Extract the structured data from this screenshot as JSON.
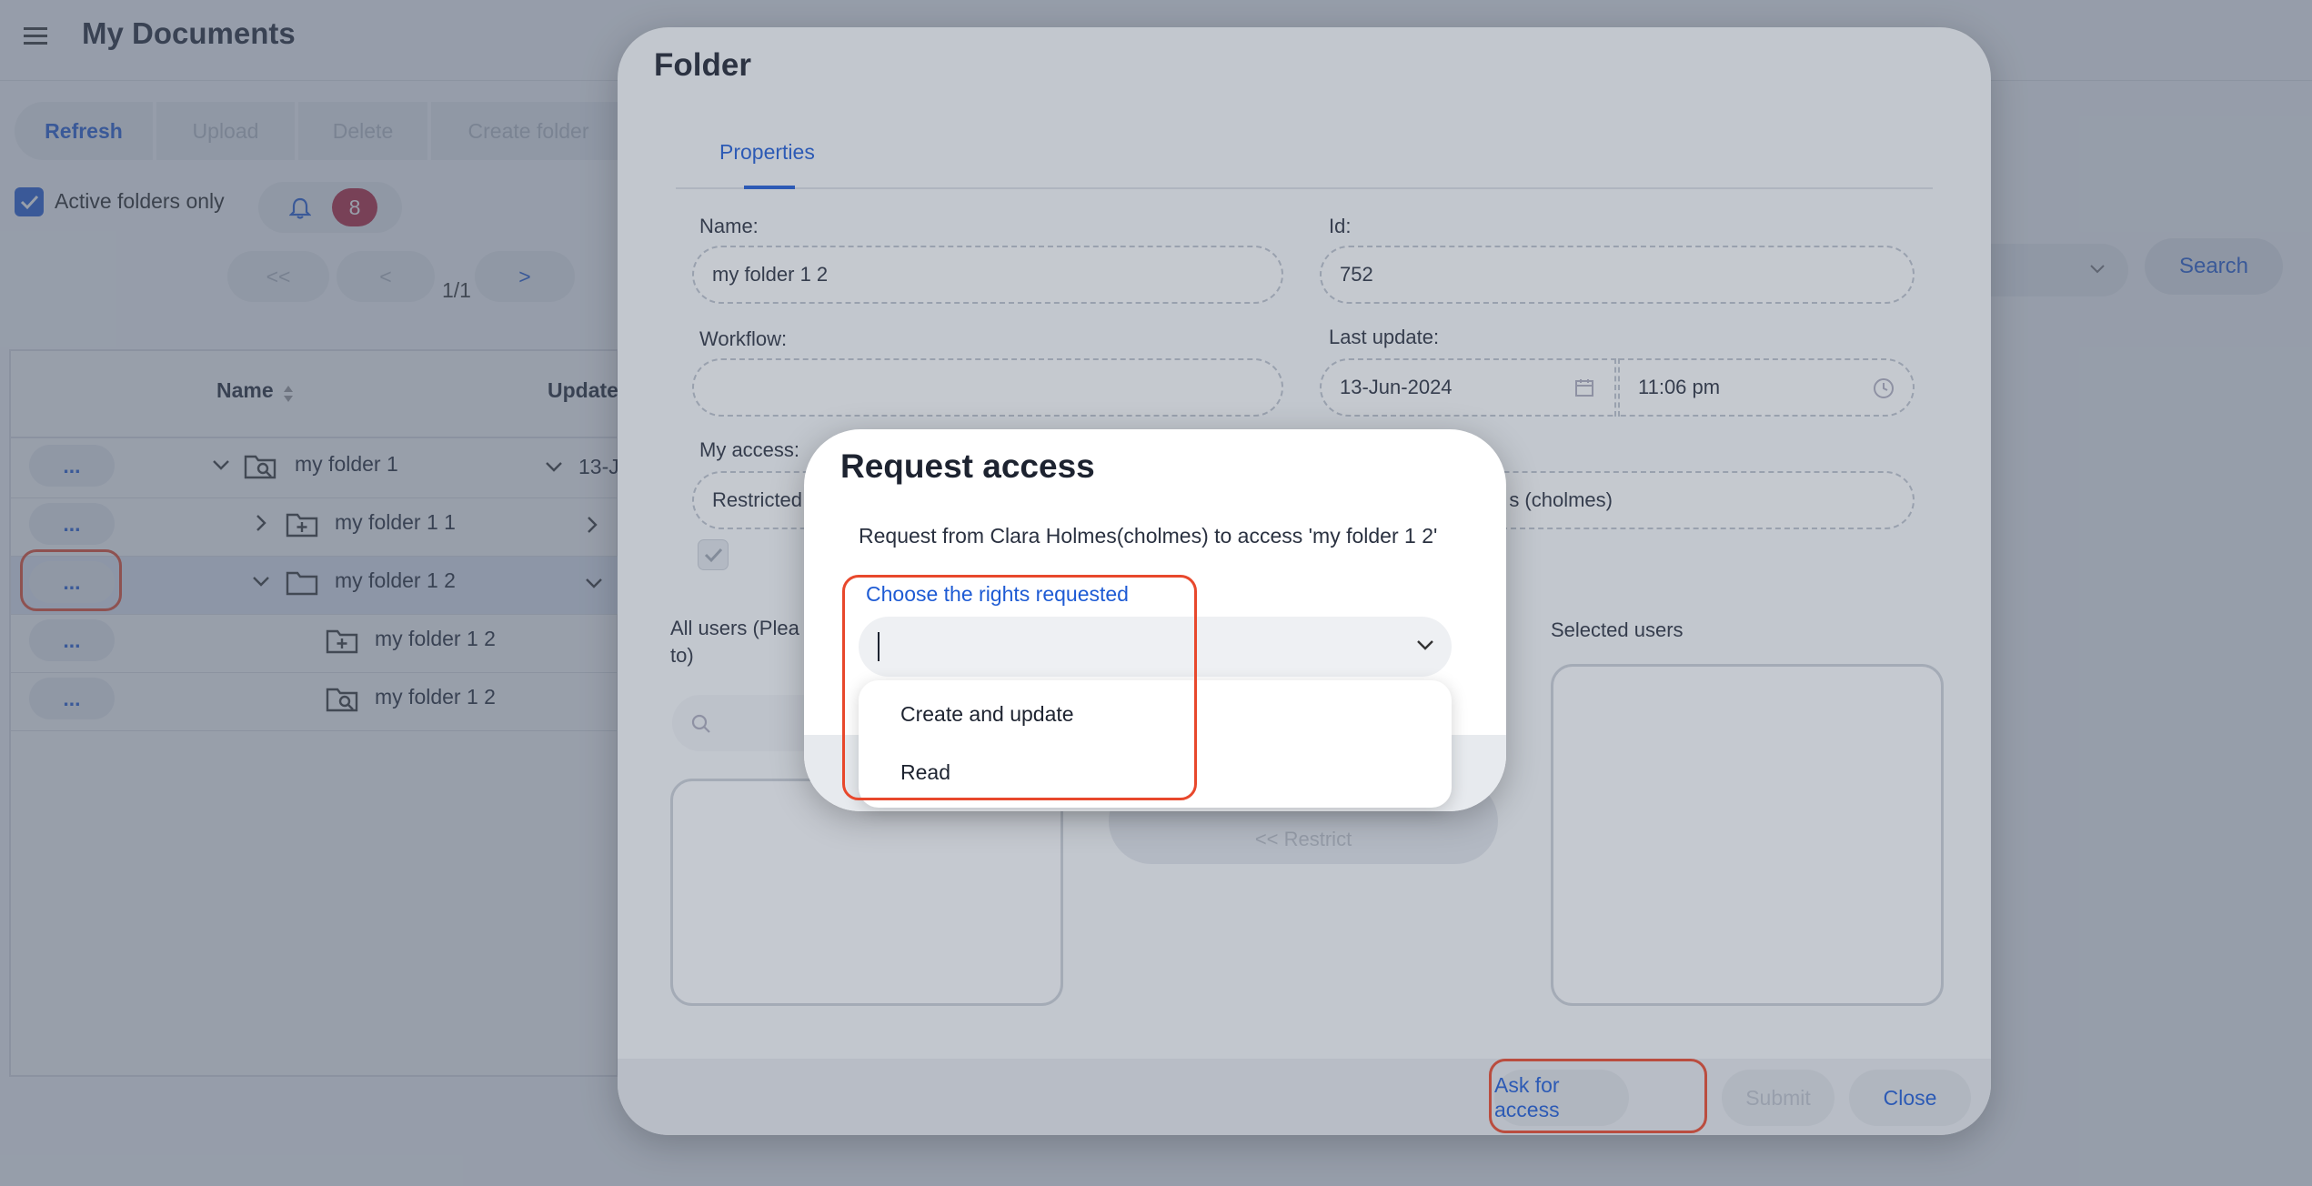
{
  "header": {
    "title": "My Documents",
    "menu_icon": "hamburger-icon"
  },
  "toolbar": {
    "buttons": [
      "Refresh",
      "Upload",
      "Delete",
      "Create folder"
    ]
  },
  "filters": {
    "active_label": "Active folders only",
    "active_checked": true,
    "notification_count": "8"
  },
  "pagination": {
    "first": "<<",
    "prev": "<",
    "page": "1/1",
    "next": ">"
  },
  "search": {
    "button": "Search"
  },
  "grid": {
    "columns": [
      "Name",
      "Update"
    ],
    "rows": [
      {
        "action": "...",
        "name": "my folder 1",
        "date": "13-J",
        "icon": "folder-search-icon",
        "expander": "chevron-down-icon"
      },
      {
        "action": "...",
        "name": "my folder 1 1",
        "date": "",
        "icon": "folder-plus-icon",
        "expander": "chevron-right-icon"
      },
      {
        "action": "...",
        "name": "my folder 1 2",
        "date": "",
        "icon": "folder-icon",
        "expander": "chevron-down-icon",
        "selected": true
      },
      {
        "action": "...",
        "name": "my folder 1 2",
        "date": "",
        "icon": "folder-plus-icon"
      },
      {
        "action": "...",
        "name": "my folder 1 2",
        "date": "",
        "icon": "folder-search-icon"
      }
    ]
  },
  "folder_dialog": {
    "title": "Folder",
    "tab": "Properties",
    "name_label": "Name:",
    "name_value": "my folder 1 2",
    "id_label": "Id:",
    "id_value": "752",
    "workflow_label": "Workflow:",
    "workflow_value": "",
    "last_update_label": "Last update:",
    "last_update_date": "13-Jun-2024",
    "last_update_time": "11:06 pm",
    "access_label": "My access:",
    "access_value": "Restricted",
    "owner_value": "s (cholmes)",
    "all_users_label": "All users (Plea",
    "all_users_label2": "to)",
    "selected_users_label": "Selected users",
    "ghost_button": "<< Restrict",
    "footer": {
      "ask": "Ask for access",
      "submit": "Submit",
      "close": "Close"
    }
  },
  "request_dialog": {
    "title": "Request access",
    "message": "Request from Clara Holmes(cholmes) to access 'my folder 1 2'",
    "rights_label": "Choose the rights requested",
    "rights_value": "",
    "options": [
      "Create and update",
      "Read"
    ]
  },
  "colors": {
    "accent": "#1e5bd4",
    "badge": "#b3213a",
    "highlight": "#e8482c"
  }
}
